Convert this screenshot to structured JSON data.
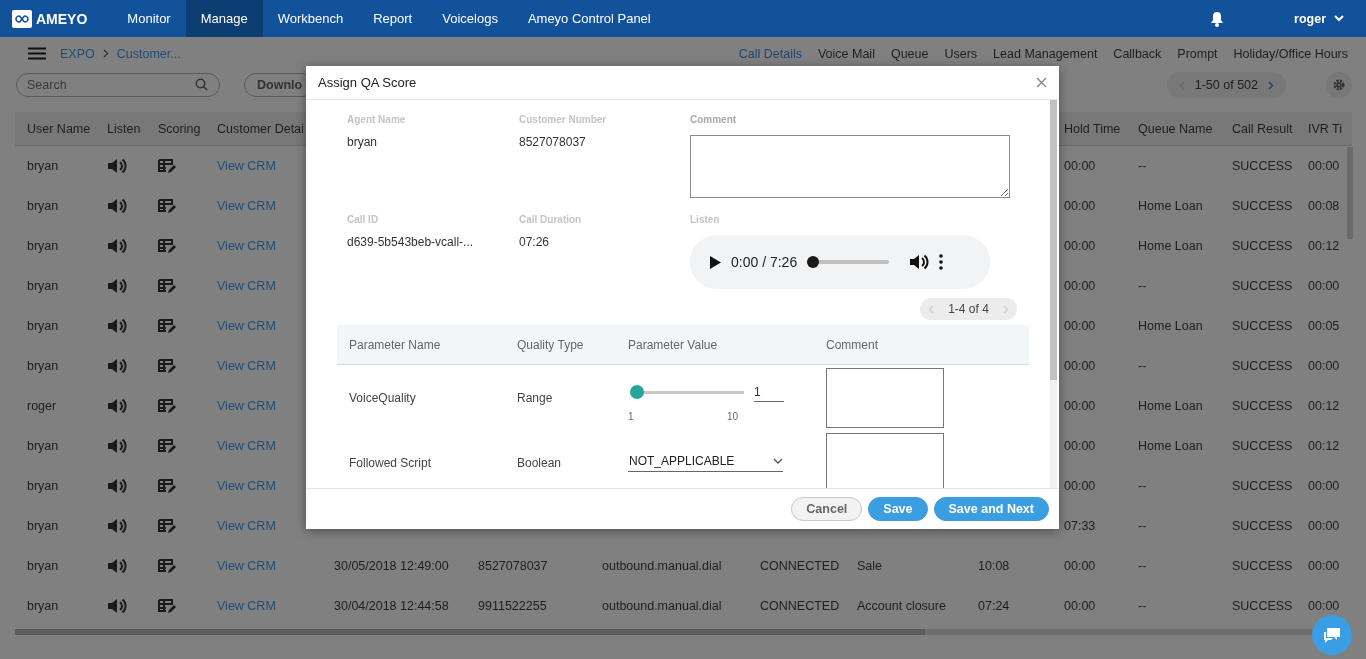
{
  "nav": {
    "logo": "AMEYO",
    "items": [
      {
        "label": "Monitor",
        "selected": false
      },
      {
        "label": "Manage",
        "selected": true
      },
      {
        "label": "Workbench",
        "selected": false
      },
      {
        "label": "Report",
        "selected": false
      },
      {
        "label": "Voicelogs",
        "selected": false
      },
      {
        "label": "Ameyo Control Panel",
        "selected": false
      }
    ],
    "user": "roger"
  },
  "subnav": {
    "breadcrumb": [
      "EXPO",
      "Customer..."
    ],
    "tabs": [
      {
        "label": "Call Details",
        "selected": true
      },
      {
        "label": "Voice Mail",
        "selected": false
      },
      {
        "label": "Queue",
        "selected": false
      },
      {
        "label": "Users",
        "selected": false
      },
      {
        "label": "Lead Management",
        "selected": false
      },
      {
        "label": "Callback",
        "selected": false
      },
      {
        "label": "Prompt",
        "selected": false
      },
      {
        "label": "Holiday/Office Hours",
        "selected": false
      }
    ]
  },
  "toolbar": {
    "search": {
      "placeholder": "Search"
    },
    "download": "Downlo",
    "pager": "1-50 of 502"
  },
  "table": {
    "columns": [
      "User Name",
      "Listen",
      "Scoring",
      "Customer Detai",
      "Hold Time",
      "Queue Name",
      "Call Result",
      "IVR Ti"
    ],
    "rows": [
      {
        "user": "bryan",
        "crm": "View CRM",
        "hold": "00:00",
        "queue": "--",
        "result": "SUCCESS",
        "ivr": "00:00"
      },
      {
        "user": "bryan",
        "crm": "View CRM",
        "hold": "00:00",
        "queue": "Home Loan",
        "result": "SUCCESS",
        "ivr": "00:08"
      },
      {
        "user": "bryan",
        "crm": "View CRM",
        "hold": "00:00",
        "queue": "Home Loan",
        "result": "SUCCESS",
        "ivr": "00:12"
      },
      {
        "user": "bryan",
        "crm": "View CRM",
        "hold": "00:00",
        "queue": "--",
        "result": "SUCCESS",
        "ivr": "00:00"
      },
      {
        "user": "bryan",
        "crm": "View CRM",
        "hold": "00:00",
        "queue": "Home Loan",
        "result": "SUCCESS",
        "ivr": "00:05"
      },
      {
        "user": "bryan",
        "crm": "View CRM",
        "hold": "00:00",
        "queue": "--",
        "result": "SUCCESS",
        "ivr": "00:00"
      },
      {
        "user": "roger",
        "crm": "View CRM",
        "hold": "00:00",
        "queue": "Home Loan",
        "result": "SUCCESS",
        "ivr": "00:12"
      },
      {
        "user": "bryan",
        "crm": "View CRM",
        "hold": "00:00",
        "queue": "Home Loan",
        "result": "SUCCESS",
        "ivr": "00:12"
      },
      {
        "user": "bryan",
        "crm": "View CRM",
        "hold": "00:00",
        "queue": "--",
        "result": "SUCCESS",
        "ivr": "00:00"
      },
      {
        "user": "bryan",
        "crm": "View CRM",
        "hold": "07:33",
        "queue": "--",
        "result": "SUCCESS",
        "ivr": "00:00"
      },
      {
        "user": "bryan",
        "crm": "View CRM",
        "date": "30/05/2018 12:49:00",
        "number": "8527078037",
        "campaign": "outbound.manual.dial",
        "status": "CONNECTED",
        "disposition": "Sale",
        "duration": "10:08",
        "hold": "00:00",
        "queue": "--",
        "result": "SUCCESS",
        "ivr": "00:00"
      },
      {
        "user": "bryan",
        "crm": "View CRM",
        "date": "30/04/2018 12:44:58",
        "number": "9911522255",
        "campaign": "outbound.manual.dial",
        "status": "CONNECTED",
        "disposition": "Account closure",
        "duration": "07:24",
        "hold": "00:00",
        "queue": "--",
        "result": "SUCCESS",
        "ivr": "00:00"
      }
    ]
  },
  "modal": {
    "title": "Assign QA Score",
    "fields": [
      {
        "label": "Agent Name",
        "value": "bryan"
      },
      {
        "label": "Customer Number",
        "value": "8527078037"
      },
      {
        "label": "Call ID",
        "value": "d639-5b543beb-vcall-..."
      },
      {
        "label": "Call Duration",
        "value": "07:26"
      }
    ],
    "comment_label": "Comment",
    "listen_label": "Listen",
    "audio": {
      "time": "0:00 / 7:26",
      "level": 0
    },
    "pager": "1-4 of 4",
    "columns": [
      "Parameter Name",
      "Quality Type",
      "Parameter Value",
      "Comment"
    ],
    "parameters": [
      {
        "kind": "range",
        "name": "VoiceQuality",
        "type": "Range",
        "level": 0,
        "min": "1",
        "max": "10",
        "value": "1"
      },
      {
        "kind": "select",
        "name": "Followed Script",
        "type": "Boolean",
        "value": "NOT_APPLICABLE"
      }
    ],
    "buttons": [
      {
        "label": "Cancel",
        "kind": "secondary"
      },
      {
        "label": "Save",
        "kind": "primary"
      },
      {
        "label": "Save and Next",
        "kind": "primary"
      }
    ]
  }
}
